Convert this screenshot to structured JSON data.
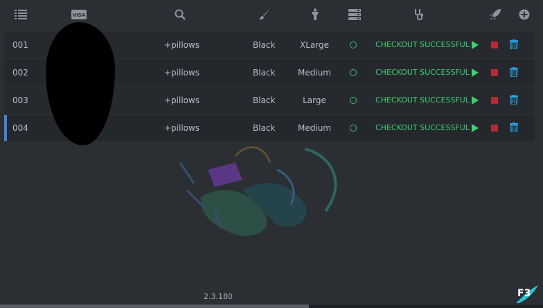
{
  "header": {
    "icons": [
      "list-icon",
      "visa-card-icon",
      "search-icon",
      "brush-icon",
      "person-size-icon",
      "server-icon",
      "stethoscope-icon",
      "rocket-icon",
      "add-circle-icon"
    ],
    "visa_label": "VISA"
  },
  "tasks": [
    {
      "id": "001",
      "product": "+pillows",
      "color": "Black",
      "size": "XLarge",
      "status": "CHECKOUT SUCCESSFUL",
      "selected": false
    },
    {
      "id": "002",
      "product": "+pillows",
      "color": "Black",
      "size": "Medium",
      "status": "CHECKOUT SUCCESSFUL",
      "selected": false
    },
    {
      "id": "003",
      "product": "+pillows",
      "color": "Black",
      "size": "Large",
      "status": "CHECKOUT SUCCESSFUL",
      "selected": false
    },
    {
      "id": "004",
      "product": "+pillows",
      "color": "Black",
      "size": "Medium",
      "status": "CHECKOUT SUCCESSFUL",
      "selected": true
    }
  ],
  "footer": {
    "version": "2.3.180",
    "logo_text": "F3"
  },
  "colors": {
    "status_green": "#3fcf6f",
    "stop_red": "#b32b35",
    "trash_blue": "#2a9de0",
    "select_blue": "#3b87d6"
  }
}
